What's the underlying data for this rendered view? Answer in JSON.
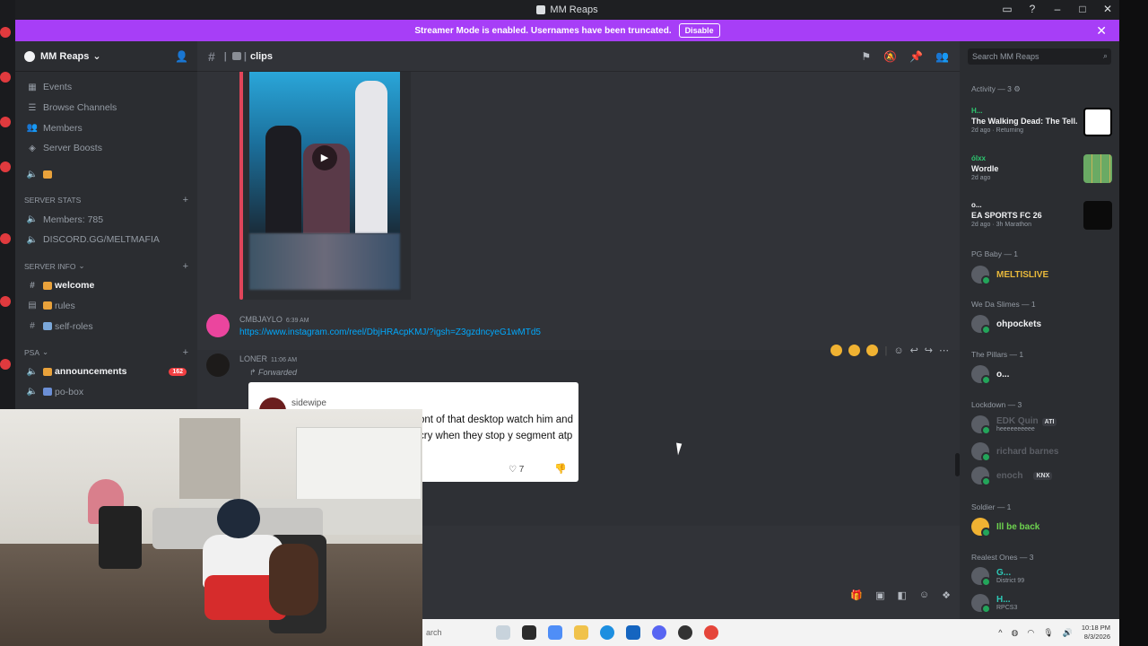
{
  "window": {
    "title": "MM Reaps"
  },
  "banner": {
    "text": "Streamer Mode is enabled. Usernames have been truncated.",
    "disable_label": "Disable"
  },
  "server": {
    "name": "MM Reaps",
    "top_items": [
      {
        "label": "Events",
        "icon": "calendar-icon"
      },
      {
        "label": "Browse Channels",
        "icon": "browse-icon"
      },
      {
        "label": "Members",
        "icon": "members-icon"
      },
      {
        "label": "Server Boosts",
        "icon": "boost-icon"
      }
    ],
    "categories": [
      {
        "name": "SERVER STATS",
        "items": [
          {
            "label": "Members: 785",
            "icon": "speaker-icon"
          },
          {
            "label": "DISCORD.GG/MELTMAFIA",
            "icon": "speaker-icon"
          }
        ]
      },
      {
        "name": "SERVER INFO",
        "items": [
          {
            "label": "welcome",
            "icon": "hash-icon",
            "bold": true
          },
          {
            "label": "rules",
            "icon": "rules-icon"
          },
          {
            "label": "self-roles",
            "icon": "hash-icon"
          }
        ]
      },
      {
        "name": "PSA",
        "items": [
          {
            "label": "announcements",
            "icon": "speaker-icon",
            "bold": true,
            "badge": "162"
          },
          {
            "label": "po-box",
            "icon": "speaker-icon"
          }
        ]
      }
    ]
  },
  "channel": {
    "name": "clips"
  },
  "messages": [
    {
      "author": "CMBJAYLO",
      "time": "6:39 AM",
      "link": "https://www.instagram.com/reel/DbjHRAcpKMJ/?igsh=Z3gzdncyeG1wMTd5"
    },
    {
      "author": "LONER",
      "time": "11:06 AM",
      "forwarded_label": "Forwarded",
      "card": {
        "user": "sidewipe",
        "text": "ont of that desktop watch him and cry when they stop y segment atp",
        "likes": "7"
      }
    }
  ],
  "search": {
    "placeholder": "Search MM Reaps"
  },
  "members_panel": {
    "activity_header": "Activity — 3",
    "activities": [
      {
        "user": "H...",
        "game": "The Walking Dead: The Tell...",
        "meta": "2d ago",
        "extra": "Returning",
        "user_color": "#2dc770"
      },
      {
        "user": "ólxx",
        "game": "Wordle",
        "meta": "2d ago",
        "extra": "",
        "user_color": "#2dc770"
      },
      {
        "user": "o...",
        "game": "EA SPORTS FC 26",
        "meta": "2d ago",
        "extra": "3h Marathon",
        "user_color": "#f2f3f5"
      }
    ],
    "groups": [
      {
        "header": "PG Baby — 1",
        "members": [
          {
            "name": "MELTISLIVE",
            "color": "#e9b93b"
          }
        ]
      },
      {
        "header": "We Da Slimes — 1",
        "members": [
          {
            "name": "ohpockets",
            "color": "#f2f3f5"
          }
        ]
      },
      {
        "header": "The Pillars — 1",
        "members": [
          {
            "name": "o...",
            "color": "#f2f3f5"
          }
        ]
      },
      {
        "header": "Lockdown — 3",
        "members": [
          {
            "name": "EDK Quin",
            "color": "#5c5f66",
            "tag": "ATI",
            "sub": "heeeeeeeeee"
          },
          {
            "name": "richard barnes",
            "color": "#5c5f66"
          },
          {
            "name": "enoch",
            "color": "#5c5f66",
            "tag": "KNX"
          }
        ]
      },
      {
        "header": "Soldier — 1",
        "members": [
          {
            "name": "Ill be back",
            "color": "#6ed34f"
          }
        ]
      },
      {
        "header": "Realest Ones — 3",
        "members": [
          {
            "name": "G...",
            "color": "#2dc7b6",
            "sub": "District 99"
          },
          {
            "name": "H...",
            "color": "#2dc7b6",
            "sub": "RPCS3"
          }
        ]
      }
    ]
  },
  "taskbar": {
    "search_placeholder": "arch",
    "time": "10:18 PM",
    "date": "8/3/2026"
  }
}
